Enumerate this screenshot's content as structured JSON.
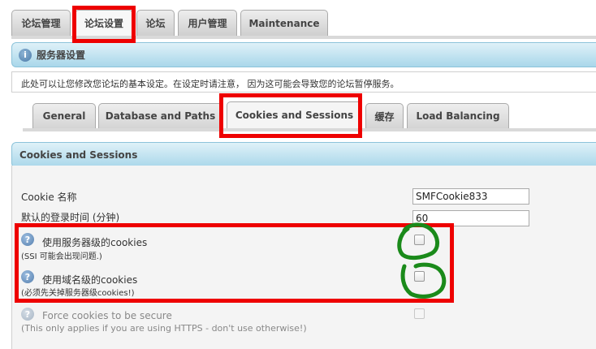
{
  "top_tabs": [
    "论坛管理",
    "论坛设置",
    "论坛",
    "用户管理",
    "Maintenance"
  ],
  "server_header": {
    "icon": "info-icon",
    "title": "服务器设置"
  },
  "description": "此处可以让您修改您论坛的基本设定。在设定时请注意， 因为这可能会导致您的论坛暂停服务。",
  "sub_tabs": [
    "General",
    "Database and Paths",
    "Cookies and Sessions",
    "缓存",
    "Load Balancing"
  ],
  "section_title": "Cookies and Sessions",
  "settings": {
    "cookie_name": {
      "label": "Cookie 名称",
      "value": "SMFCookie833"
    },
    "login_length": {
      "label": "默认的登录时间 (分钟)",
      "value": "60"
    },
    "local_cookies": {
      "label": "使用服务器级的cookies",
      "note": "(SSI 可能会出现问题.)",
      "checked": false
    },
    "global_cookies": {
      "label": "使用域名级的cookies",
      "note": "(必须先关掉服务器级cookies!)",
      "checked": false
    },
    "secure_cookies": {
      "label": "Force cookies to be secure",
      "note": "(This only applies if you are using HTTPS - don't use otherwise!)",
      "checked": false,
      "disabled": true
    }
  },
  "colors": {
    "highlight_box": "#ee0000",
    "handdrawn_annotation": "#1a8a1a",
    "header_bar": "#b7dcec"
  }
}
